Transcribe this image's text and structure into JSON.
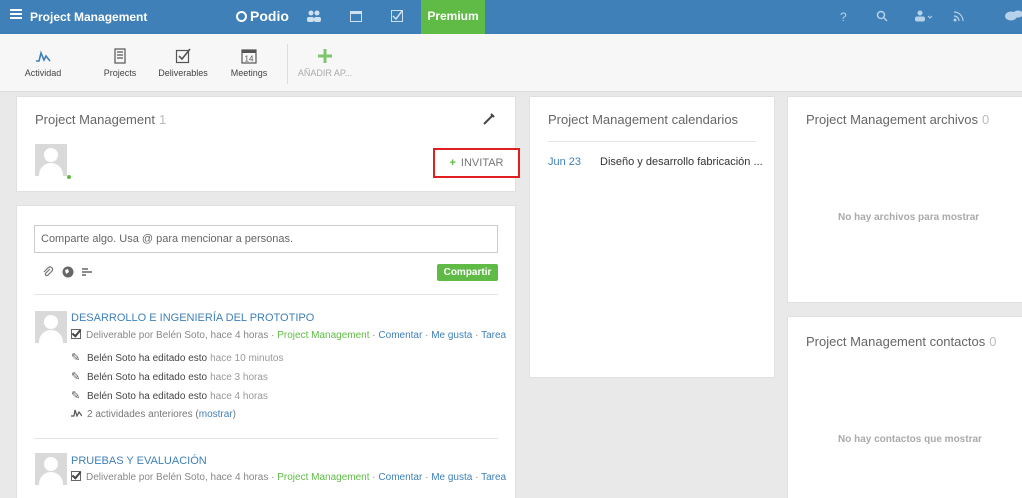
{
  "topbar": {
    "workspace_title": "Project Management",
    "logo_text": "Podio",
    "premium_label": "Premium",
    "help_label": "?"
  },
  "apps": [
    {
      "label": "Actividad",
      "icon": "activity-icon"
    },
    {
      "label": "Projects",
      "icon": "projects-icon"
    },
    {
      "label": "Deliverables",
      "icon": "deliverables-icon"
    },
    {
      "label": "Meetings",
      "icon": "calendar-14-icon",
      "badge": "14"
    },
    {
      "label": "AÑADIR AP...",
      "icon": "plus-icon"
    }
  ],
  "members_card": {
    "title": "Project Management",
    "count": "1",
    "invite_label": "INVITAR",
    "invite_plus": "+"
  },
  "share": {
    "placeholder": "Comparte algo. Usa @ para mencionar a personas.",
    "button_label": "Compartir"
  },
  "feed": [
    {
      "title": "DESARROLLO E INGENIERÍA DEL PROTOTIPO",
      "meta_prefix": "Deliverable por Belén Soto, hace 4 horas ·",
      "meta_workspace": "Project Management",
      "meta_actions": [
        "Comentar",
        "Me gusta",
        "Tarea"
      ],
      "activities": [
        {
          "text": "Belén Soto ha editado esto",
          "time": "hace 10 minutos"
        },
        {
          "text": "Belén Soto ha editado esto",
          "time": "hace 3 horas"
        },
        {
          "text": "Belén Soto ha editado esto",
          "time": "hace 4 horas"
        }
      ],
      "previous_prefix": "2 actividades anteriores (",
      "previous_link": "mostrar",
      "previous_suffix": ")"
    },
    {
      "title": "PRUEBAS Y EVALUACIÓN",
      "meta_prefix": "Deliverable por Belén Soto, hace 4 horas ·",
      "meta_workspace": "Project Management",
      "meta_actions": [
        "Comentar",
        "Me gusta",
        "Tarea"
      ]
    }
  ],
  "calendar_card": {
    "title": "Project Management calendarios",
    "events": [
      {
        "date": "Jun 23",
        "title": "Diseño y desarrollo fabricación ..."
      }
    ]
  },
  "files_card": {
    "title": "Project Management archivos",
    "count": "0",
    "empty": "No hay archivos para mostrar"
  },
  "contacts_card": {
    "title": "Project Management contactos",
    "count": "0",
    "empty": "No hay contactos que mostrar"
  },
  "colors": {
    "topbar": "#3f80b8",
    "accent_green": "#5fbb46",
    "link": "#3f80b8",
    "highlight": "#e02020"
  }
}
